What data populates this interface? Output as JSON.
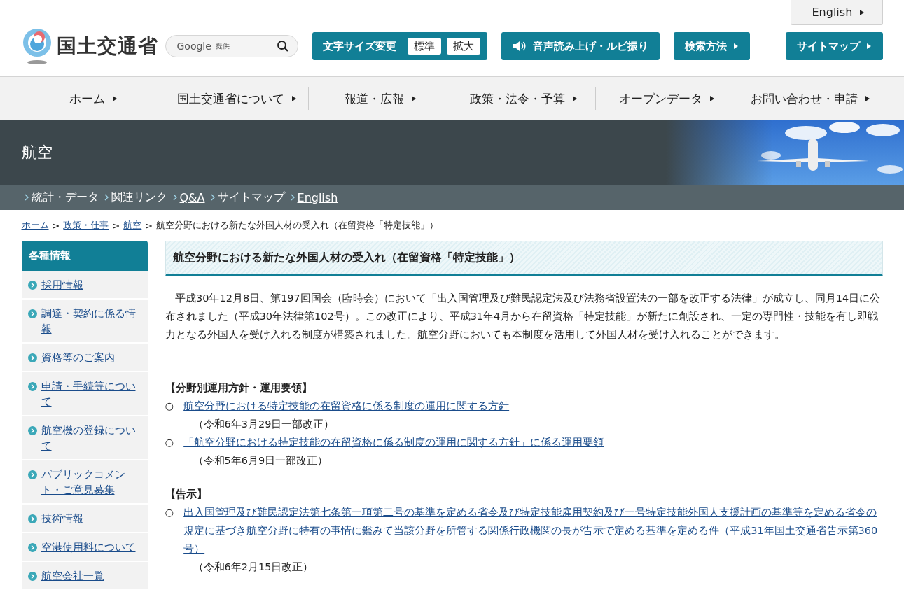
{
  "header": {
    "logo_text": "国土交通省",
    "search": {
      "brand": "Google",
      "note": "提供"
    },
    "english_link": "English",
    "text_size": {
      "label": "文字サイズ変更",
      "options": [
        "標準",
        "拡大"
      ]
    },
    "buttons": [
      {
        "label": "音声読み上げ・ルビ振り",
        "kind": "speaker"
      },
      {
        "label": "検索方法",
        "kind": "arrow"
      },
      {
        "label": "サイトマップ",
        "kind": "arrow"
      }
    ]
  },
  "nav": [
    "ホーム",
    "国土交通省について",
    "報道・広報",
    "政策・法令・予算",
    "オープンデータ",
    "お問い合わせ・申請"
  ],
  "banner": {
    "title": "航空",
    "links": [
      "統計・データ",
      "関連リンク",
      "Q&A",
      "サイトマップ",
      "English"
    ]
  },
  "breadcrumb": [
    {
      "label": "ホーム",
      "kind": "link",
      "separator": ">"
    },
    {
      "label": "政策・仕事",
      "kind": "link",
      "separator": ">"
    },
    {
      "label": "航空",
      "kind": "link",
      "separator": ">"
    },
    {
      "label": "航空分野における新たな外国人材の受入れ（在留資格「特定技能」）",
      "kind": "current"
    }
  ],
  "sidebar": {
    "title": "各種情報",
    "items": [
      "採用情報",
      "調達・契約に係る情報",
      "資格等のご案内",
      "申請・手続等について",
      "航空機の登録について",
      "パブリックコメント・ご意見募集",
      "技術情報",
      "空港使用料について",
      "航空会社一覧"
    ]
  },
  "content": {
    "title": "航空分野における新たな外国人材の受入れ（在留資格「特定技能」）",
    "paragraph": "平成30年12月8日、第197回国会（臨時会）において「出入国管理及び難民認定法及び法務省設置法の一部を改正する法律」が成立し、同月14日に公布されました（平成30年法律第102号）。この改正により、平成31年4月から在留資格「特定技能」が新たに創設され、一定の専門性・技能を有し即戦力となる外国人を受け入れる制度が構築されました。航空分野においても本制度を活用して外国人材を受け入れることができます。",
    "sections": [
      {
        "heading": "【分野別運用方針・運用要領】",
        "items": [
          {
            "bullet": "○",
            "link": "航空分野における特定技能の在留資格に係る制度の運用に関する方針",
            "note": "（令和6年3月29日一部改正）"
          },
          {
            "bullet": "○",
            "link": "「航空分野における特定技能の在留資格に係る制度の運用に関する方針」に係る運用要領",
            "note": "（令和5年6月9日一部改正）"
          }
        ]
      },
      {
        "heading": "【告示】",
        "items": [
          {
            "bullet": "○",
            "link": "出入国管理及び難民認定法第七条第一項第二号の基準を定める省令及び特定技能雇用契約及び一号特定技能外国人支援計画の基準等を定める省令の規定に基づき航空分野に特有の事情に鑑みて当該分野を所管する関係行政機関の長が告示で定める基準を定める件（平成31年国土交通省告示第360号）",
            "note": "（令和6年2月15日改正）"
          }
        ]
      }
    ]
  }
}
